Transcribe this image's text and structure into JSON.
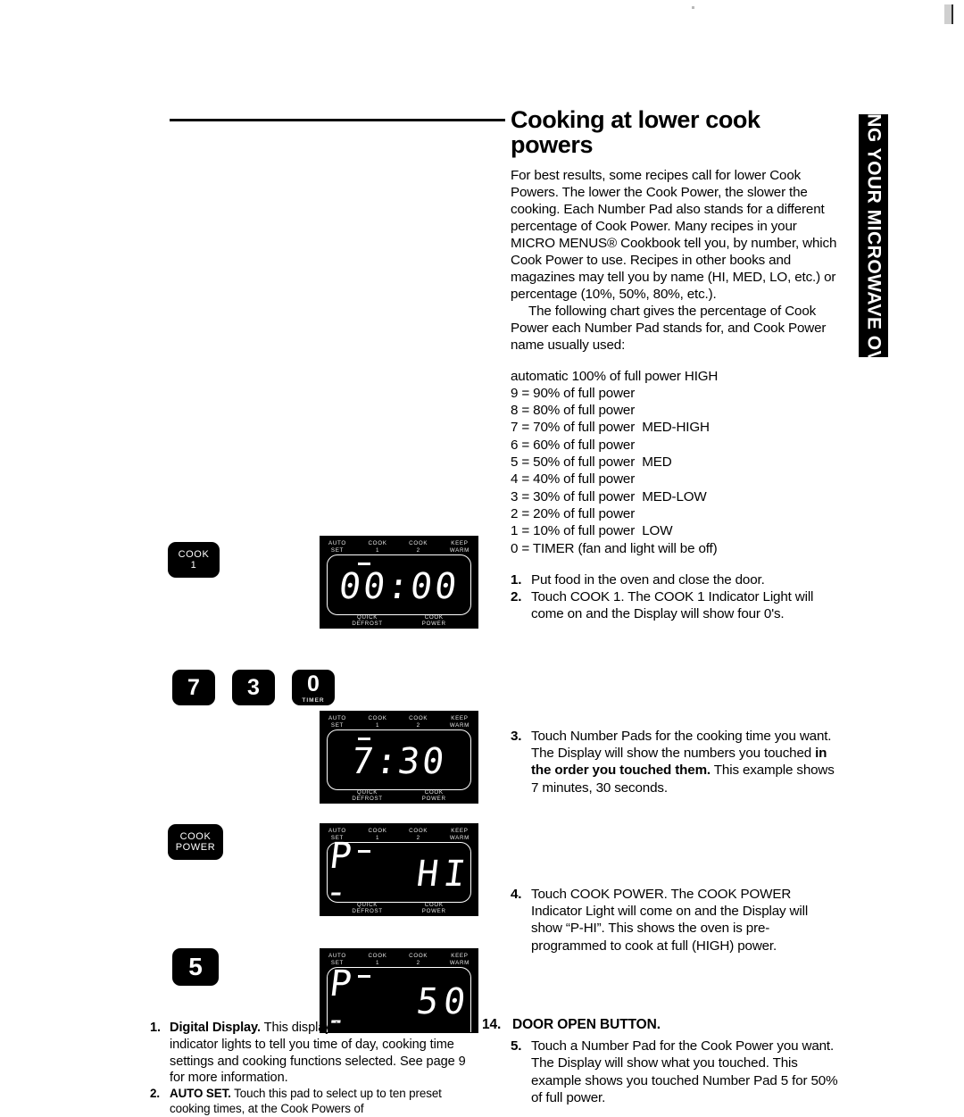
{
  "page": {
    "side_tab_label": "USING YOUR MICROWAVE OVEN"
  },
  "article": {
    "title": "Cooking at lower cook powers",
    "paragraph1": "For best results, some recipes call for lower Cook Powers. The lower the Cook Power, the slower the cooking. Each Number Pad also stands for a different percentage of Cook Power. Many recipes in your MICRO MENUS® Cookbook tell you, by number, which Cook Power to use. Recipes in other books and magazines may tell you by name (HI, MED, LO, etc.) or percentage (10%, 50%, 80%, etc.).",
    "paragraph2": "The following chart gives the percentage of Cook Power each Number Pad stands for, and Cook Power name usually used:"
  },
  "power_chart": [
    "automatic 100% of full power HIGH",
    "9 = 90% of full power",
    "8 = 80% of full power",
    "7 = 70% of full power  MED-HIGH",
    "6 = 60% of full power",
    "5 = 50% of full power  MED",
    "4 = 40% of full power",
    "3 = 30% of full power  MED-LOW",
    "2 = 20% of full power",
    "1 = 10% of full power  LOW",
    "0 = TIMER (fan and light will be off)"
  ],
  "steps": [
    {
      "num": "1.",
      "text": "Put food in the oven and close the door."
    },
    {
      "num": "2.",
      "text": "Touch COOK 1. The COOK 1 Indicator Light will come on and the Display will show four 0's."
    },
    {
      "num": "3.",
      "text_before": "Touch Number Pads for the cooking time you want. The Display will show the numbers you touched ",
      "bold": "in the order you touched them.",
      "text_after": " This example shows 7 minutes, 30 seconds."
    },
    {
      "num": "4.",
      "text": "Touch COOK POWER. The COOK POWER Indicator Light will come on and the Display will show “P-HI”. This shows the oven is pre-programmed to cook at full (HIGH) power."
    },
    {
      "num": "5.",
      "text": "Touch a Number Pad for the Cook Power you want. The Display will show what you touched. This example shows you touched Number Pad 5 for 50% of full power."
    }
  ],
  "door_open": {
    "num": "14.",
    "label": "DOOR OPEN BUTTON."
  },
  "panel_labels": {
    "auto_set": "AUTO\nSET",
    "cook_1": "COOK\n1",
    "cook_2": "COOK\n2",
    "keep_warm": "KEEP\nWARM",
    "quick_defrost": "QUICK\nDEFROST",
    "cook_power": "COOK\nPOWER"
  },
  "figures": {
    "cook1_button": {
      "line1": "COOK",
      "line2": "1"
    },
    "cook_power_button": {
      "line1": "COOK",
      "line2": "POWER"
    },
    "pad_7": "7",
    "pad_3": "3",
    "pad_0": "0",
    "pad_0_sub": "TIMER",
    "pad_5": "5",
    "display_00_00_left": "00",
    "display_00_00_sep": ":",
    "display_00_00_right": "00",
    "display_730_left": "7",
    "display_730_sep": ":",
    "display_730_right": "30",
    "display_phi_left": "P -",
    "display_phi_right": "HI",
    "display_p50_left": "P -",
    "display_p50_right": "50"
  },
  "bottom_left": {
    "item1_num": "1.",
    "item1_bold": "Digital Display.",
    "item1_text": " This display includes clock and indicator lights to tell you time of day, cooking time settings and cooking functions selected. See page 9 for more information.",
    "item2_num": "2.",
    "item2_bold": "AUTO SET.",
    "item2_text": " Touch this pad to select up to ten preset cooking times, at the Cook Powers of"
  }
}
